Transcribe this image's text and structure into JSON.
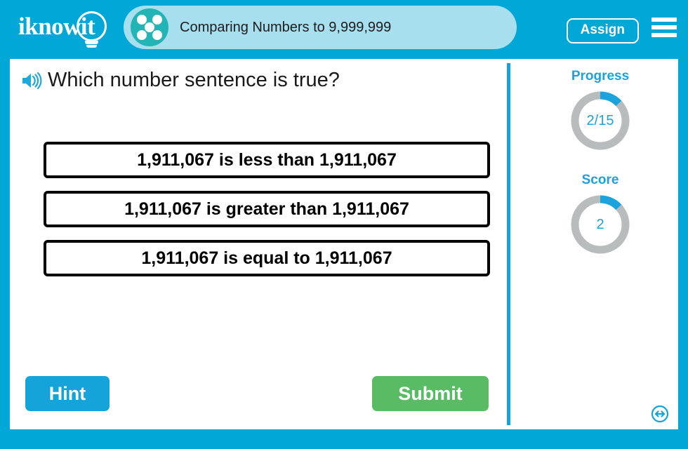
{
  "header": {
    "logo_text": "iknowit",
    "logo_icon": "lightbulb-icon",
    "topic_icon": "five-dots-circle-icon",
    "title": "Comparing Numbers to 9,999,999",
    "assign_label": "Assign",
    "menu_icon": "hamburger-menu-icon",
    "background_color": "#00a7d7",
    "pill_color": "#a7dfee",
    "topic_icon_color": "#23b5b5"
  },
  "question": {
    "audio_icon": "speaker-icon",
    "text": "Which number sentence is true?"
  },
  "answers": [
    {
      "text": "1,911,067 is less than 1,911,067"
    },
    {
      "text": "1,911,067 is greater than 1,911,067"
    },
    {
      "text": "1,911,067 is equal to 1,911,067"
    }
  ],
  "actions": {
    "hint_label": "Hint",
    "hint_color": "#14a4da",
    "submit_label": "Submit",
    "submit_color": "#59bb63"
  },
  "sidebar": {
    "progress": {
      "label": "Progress",
      "value_text": "2/15",
      "current": 2,
      "total": 15,
      "percent": 13,
      "arc_color": "#1ba3dd",
      "track_color": "#b8bcbd"
    },
    "score": {
      "label": "Score",
      "value_text": "2",
      "current": 2,
      "percent": 13,
      "arc_color": "#1ba3dd",
      "track_color": "#b8bcbd"
    }
  },
  "footer": {
    "resize_icon": "resize-horizontal-circle-icon",
    "icon_color": "#14a4da"
  }
}
